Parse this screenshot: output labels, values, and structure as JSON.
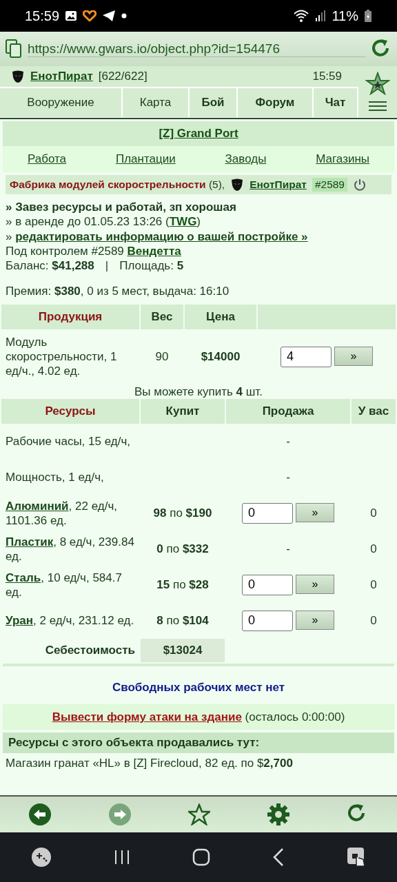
{
  "status_bar": {
    "time": "15:59",
    "battery": "11%"
  },
  "address_bar": {
    "url": "https://www.gwars.io/object.php?id=154476"
  },
  "header": {
    "user": "ЕнотПират",
    "hp": "[622/622]",
    "time": "15:59"
  },
  "nav": [
    {
      "label": "Вооружение",
      "bold": false
    },
    {
      "label": "Карта",
      "bold": false
    },
    {
      "label": "Бой",
      "bold": true
    },
    {
      "label": "Форум",
      "bold": true
    },
    {
      "label": "Чат",
      "bold": true
    }
  ],
  "location": "[Z] Grand Port",
  "sections": [
    "Работа",
    "Плантации",
    "Заводы",
    "Магазины"
  ],
  "building": {
    "title": "Фабрика модулей скорострельности",
    "level": "(5),",
    "owner": "ЕнотПират",
    "owner_id": "#2589"
  },
  "info": {
    "motto": "» Завез ресурсы и работай, зп хорошая",
    "rent": {
      "prefix": "» в аренде до 01.05.23 13:26 (",
      "link": "TWG",
      "suffix": ")"
    },
    "edit": {
      "prefix": "»",
      "link": "редактировать информацию о вашей постройке »"
    },
    "control": {
      "prefix": "Под контролем #2589",
      "link": "Вендетта"
    },
    "balance": "Баланс: **$41,288**",
    "separator": "|",
    "area": "Площадь: **5**",
    "premium": "Премия: **$380**, 0 из 5 мест, выдача: 16:10"
  },
  "product_table": {
    "columns": [
      "Продукция",
      "Вес",
      "Цена"
    ],
    "row": {
      "name": "Модуль скорострельности, 1 ед/ч., 4.02 ед.",
      "weight": "90",
      "price": "$14000",
      "quantity": "4",
      "button": "»"
    }
  },
  "buy_note": "Вы можете купить **4** шт.",
  "resource_table": {
    "columns": [
      "Ресурсы",
      "Купит",
      "Продажа",
      "У вас"
    ],
    "rows": [
      {
        "name": "Рабочие часы, 15 ед/ч,",
        "sale": {
          "kind": "dash",
          "text": "-"
        }
      },
      {
        "name": "Мощность, 1 ед/ч,",
        "sale": {
          "kind": "dash",
          "text": "-"
        }
      },
      {
        "link": "Алюминий",
        "name": ", 22 ед/ч, 1101.36 ед.",
        "buy": "**98** по **$190**",
        "sale": {
          "kind": "input",
          "value": "0",
          "button": "»"
        },
        "have": "0"
      },
      {
        "link": "Пластик",
        "name": ", 8 ед/ч, 239.84 ед.",
        "buy": "**0** по **$332**",
        "sale": {
          "kind": "dash",
          "text": "-"
        },
        "have": "0"
      },
      {
        "link": "Сталь",
        "name": ", 10 ед/ч, 584.7 ед.",
        "buy": "**15** по **$28**",
        "sale": {
          "kind": "input",
          "value": "0",
          "button": "»"
        },
        "have": "0"
      },
      {
        "link": "Уран",
        "name": ", 2 ед/ч, 231.12 ед.",
        "buy": "**8** по **$104**",
        "sale": {
          "kind": "input",
          "value": "0",
          "button": "»"
        },
        "have": "0"
      }
    ],
    "cost_label": "Себестоимость",
    "cost_value": "$13024"
  },
  "no_jobs": "Свободных рабочих мест нет",
  "attack": {
    "link": "Вывести форму атаки на здание",
    "note": "(осталось 0:00:00)"
  },
  "sold_header": "Ресурсы с этого объекта продавались тут:",
  "sold_items": [
    "Магазин гранат «HL» в [Z] Firecloud, 82 ед. по $**2,700**"
  ],
  "toolbar": [
    {
      "kind": "back",
      "disabled": false
    },
    {
      "kind": "forward",
      "disabled": true
    },
    {
      "kind": "star",
      "disabled": false
    },
    {
      "kind": "settings",
      "disabled": false
    },
    {
      "kind": "reload",
      "disabled": false
    }
  ]
}
